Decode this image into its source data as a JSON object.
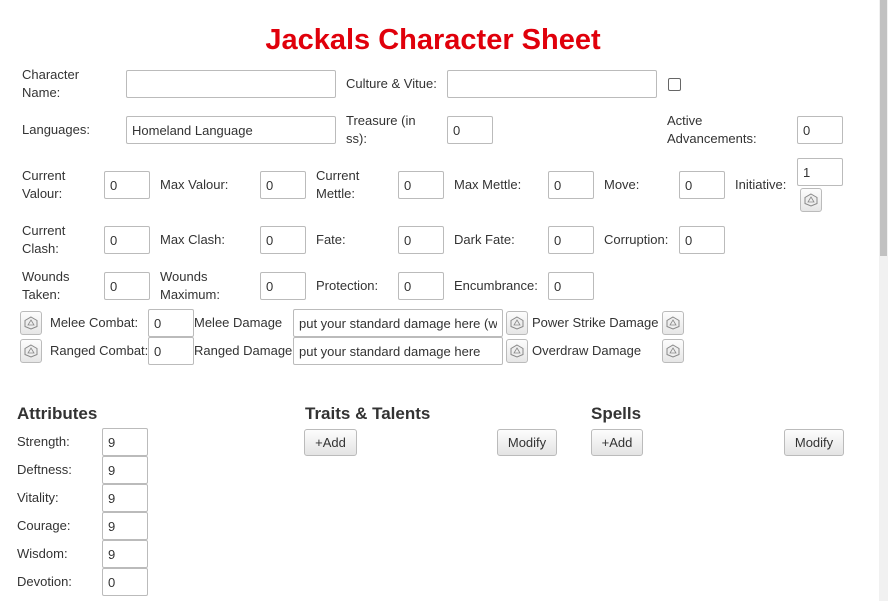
{
  "title": "Jackals Character Sheet",
  "fields": {
    "character_name": {
      "label": "Character Name:",
      "value": ""
    },
    "culture": {
      "label": "Culture & Vitue:",
      "value": ""
    },
    "languages": {
      "label": "Languages:",
      "value": "Homeland Language"
    },
    "treasure": {
      "label": "Treasure (in ss):",
      "value": "0"
    },
    "active_adv": {
      "label": "Active Advancements:",
      "value": "0"
    },
    "current_valour": {
      "label": "Current Valour:",
      "value": "0"
    },
    "max_valour": {
      "label": "Max Valour:",
      "value": "0"
    },
    "current_mettle": {
      "label": "Current Mettle:",
      "value": "0"
    },
    "max_mettle": {
      "label": "Max Mettle:",
      "value": "0"
    },
    "move": {
      "label": "Move:",
      "value": "0"
    },
    "initiative": {
      "label": "Initiative:",
      "value": "1"
    },
    "current_clash": {
      "label": "Current Clash:",
      "value": "0"
    },
    "max_clash": {
      "label": "Max Clash:",
      "value": "0"
    },
    "fate": {
      "label": "Fate:",
      "value": "0"
    },
    "dark_fate": {
      "label": "Dark Fate:",
      "value": "0"
    },
    "corruption": {
      "label": "Corruption:",
      "value": "0"
    },
    "wounds_taken": {
      "label": "Wounds Taken:",
      "value": "0"
    },
    "wounds_max": {
      "label": "Wounds Maximum:",
      "value": "0"
    },
    "protection": {
      "label": "Protection:",
      "value": "0"
    },
    "encumbrance": {
      "label": "Encumbrance:",
      "value": "0"
    }
  },
  "combat": {
    "melee": {
      "label": "Melee Combat:",
      "value": "0",
      "damage_label": "Melee Damage",
      "damage_value": "put your standard damage here (w",
      "strike_label": "Power Strike Damage"
    },
    "ranged": {
      "label": "Ranged Combat:",
      "value": "0",
      "damage_label": "Ranged Damage",
      "damage_value": "put your standard damage here",
      "strike_label": "Overdraw Damage"
    }
  },
  "attributes": {
    "heading": "Attributes",
    "items": [
      {
        "label": "Strength:",
        "value": "9"
      },
      {
        "label": "Deftness:",
        "value": "9"
      },
      {
        "label": "Vitality:",
        "value": "9"
      },
      {
        "label": "Courage:",
        "value": "9"
      },
      {
        "label": "Wisdom:",
        "value": "9"
      },
      {
        "label": "Devotion:",
        "value": "0"
      }
    ]
  },
  "traits": {
    "heading": "Traits & Talents",
    "add_label": "+Add",
    "modify_label": "Modify"
  },
  "spells": {
    "heading": "Spells",
    "add_label": "+Add",
    "modify_label": "Modify"
  },
  "icons": {
    "dice": "dice-icon"
  }
}
